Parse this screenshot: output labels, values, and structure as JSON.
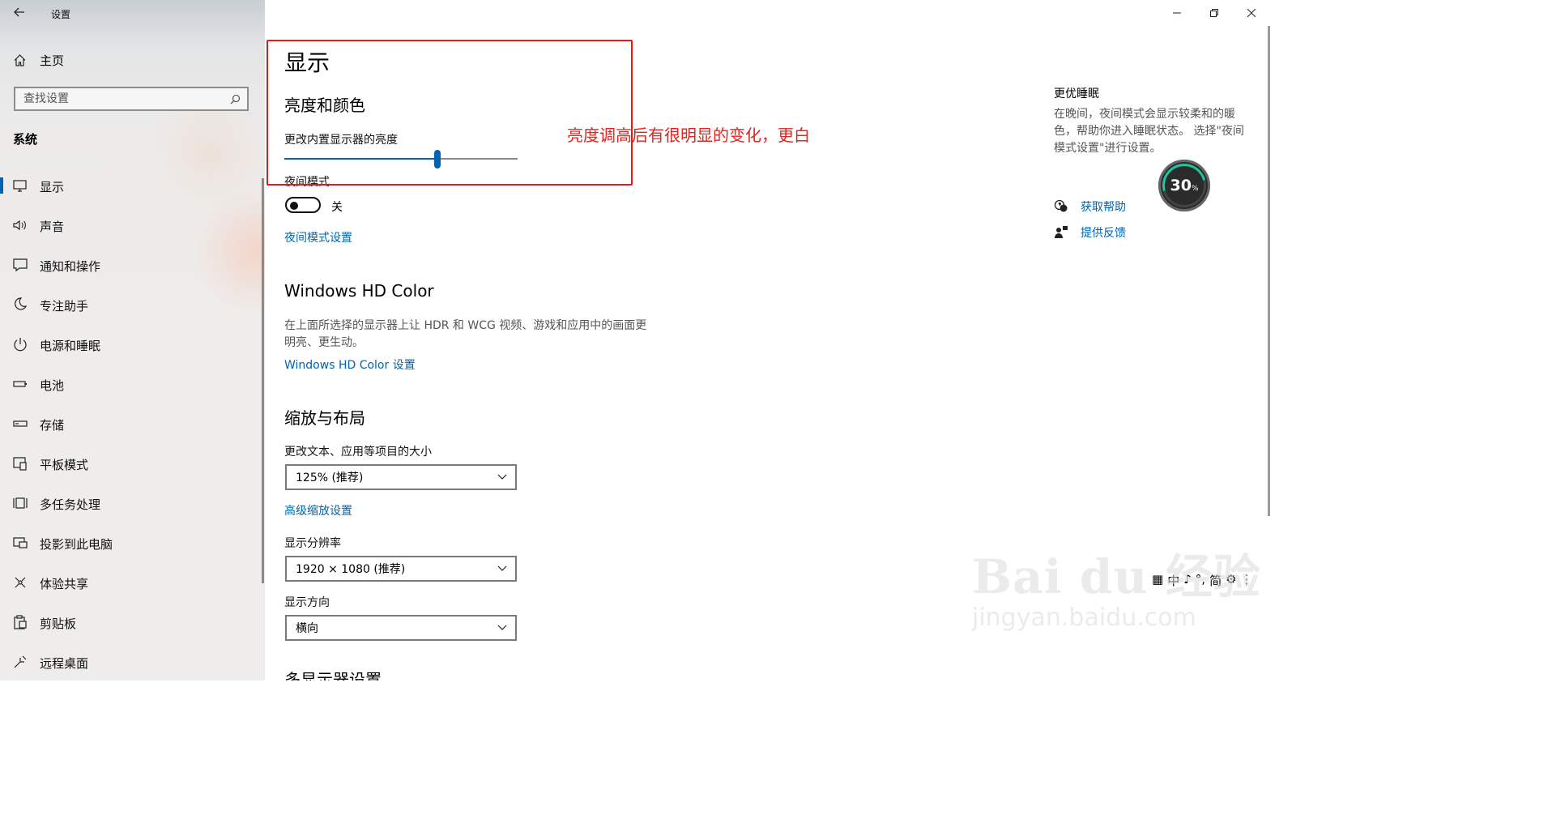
{
  "window": {
    "title": "设置",
    "controls": [
      "minimize",
      "restore",
      "close"
    ]
  },
  "sidebar": {
    "home_label": "主页",
    "search_placeholder": "查找设置",
    "section_title": "系统",
    "items": [
      {
        "label": "显示",
        "icon": "monitor-icon",
        "active": true
      },
      {
        "label": "声音",
        "icon": "speaker-icon"
      },
      {
        "label": "通知和操作",
        "icon": "notification-icon"
      },
      {
        "label": "专注助手",
        "icon": "moon-icon"
      },
      {
        "label": "电源和睡眠",
        "icon": "power-icon"
      },
      {
        "label": "电池",
        "icon": "battery-icon"
      },
      {
        "label": "存储",
        "icon": "storage-icon"
      },
      {
        "label": "平板模式",
        "icon": "tablet-icon"
      },
      {
        "label": "多任务处理",
        "icon": "multitask-icon"
      },
      {
        "label": "投影到此电脑",
        "icon": "project-icon"
      },
      {
        "label": "体验共享",
        "icon": "share-icon"
      },
      {
        "label": "剪贴板",
        "icon": "clipboard-icon"
      },
      {
        "label": "远程桌面",
        "icon": "remote-desktop-icon"
      }
    ]
  },
  "main": {
    "page_title": "显示",
    "brightness": {
      "heading": "亮度和颜色",
      "slider_label": "更改内置显示器的亮度",
      "slider_value": 0.66
    },
    "night_light": {
      "label": "夜间模式",
      "state_label": "关",
      "is_on": false,
      "settings_link": "夜间模式设置"
    },
    "hd_color": {
      "heading": "Windows HD Color",
      "description": "在上面所选择的显示器上让 HDR 和 WCG 视频、游戏和应用中的画面更明亮、更生动。",
      "link": "Windows HD Color 设置"
    },
    "scale_layout": {
      "heading": "缩放与布局",
      "text_size_label": "更改文本、应用等项目的大小",
      "text_size_value": "125% (推荐)",
      "advanced_link": "高级缩放设置",
      "resolution_label": "显示分辨率",
      "resolution_value": "1920 × 1080 (推荐)",
      "orientation_label": "显示方向",
      "orientation_value": "横向"
    },
    "multi_display_heading": "多显示器设置"
  },
  "right_panel": {
    "title": "更优睡眠",
    "description": "在晚间，夜间模式会显示较柔和的暖色，帮助你进入睡眠状态。 选择\"夜间模式设置\"进行设置。",
    "help_link": "获取帮助",
    "feedback_link": "提供反馈"
  },
  "annotation": {
    "text": "亮度调高后有很明显的变化，更白",
    "color": "#e8221c"
  },
  "overlay_badge": {
    "value": "30",
    "unit": "%"
  },
  "ime_bar": [
    "中",
    "♪",
    "°,",
    "简",
    "⚙",
    "⋮"
  ],
  "watermark": {
    "logo_text": "Bai du 经验",
    "url": "jingyan.baidu.com"
  },
  "colors": {
    "accent": "#0063b1",
    "annotation_red": "#e81818",
    "sidebar_bg": "#eeedec"
  }
}
